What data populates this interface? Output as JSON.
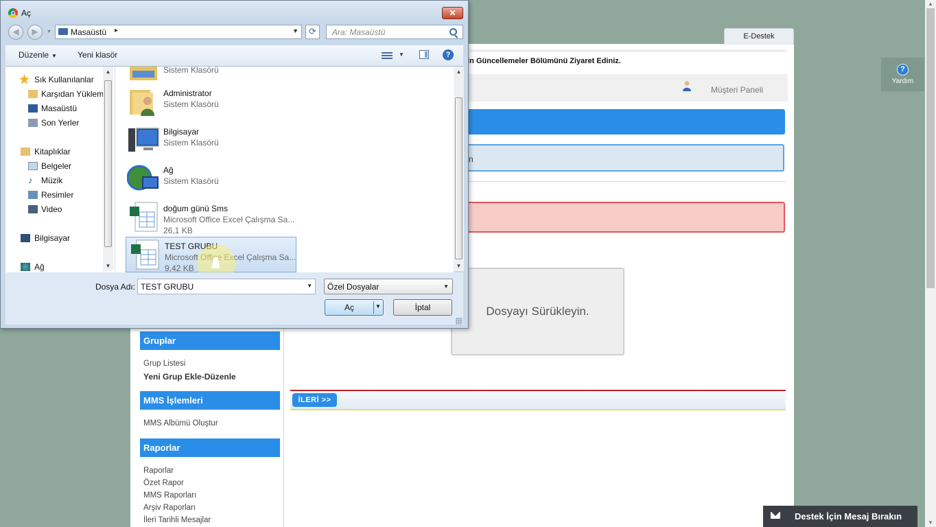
{
  "browser_page": {
    "tab_label": "E-Destek",
    "notice_text": "çin Güncellemeler Bölümünü Ziyaret Ediniz.",
    "customer_panel": "Müşteri Paneli",
    "info_fragment": "n",
    "drop_zone_text": "Dosyayı Sürükleyin.",
    "next_button": "İLERİ >>",
    "help_label": "Yardım",
    "chat_label": "Destek İçin Mesaj Bırakın",
    "sidebar": {
      "groups_header": "Gruplar",
      "groups_items": [
        "Grup Listesi",
        "Yeni Grup Ekle-Düzenle"
      ],
      "mms_header": "MMS İşlemleri",
      "mms_items": [
        "MMS Albümü Oluştur"
      ],
      "reports_header": "Raporlar",
      "reports_items": [
        "Raporlar",
        "Özet Rapor",
        "MMS Raporları",
        "Arşiv Raporları",
        "İleri Tarihli Mesajlar"
      ]
    }
  },
  "dialog": {
    "title": "Aç",
    "close_label": "✕",
    "address": {
      "location": "Masaüstü",
      "separator": "▸"
    },
    "search_placeholder": "Ara: Masaüstü",
    "toolbar": {
      "organize": "Düzenle",
      "new_folder": "Yeni klasör",
      "help": "?"
    },
    "nav_pane": {
      "favorites": "Sık Kullanılanlar",
      "favorites_items": [
        "Karşıdan Yüklem",
        "Masaüstü",
        "Son Yerler"
      ],
      "libraries": "Kitaplıklar",
      "libraries_items": [
        "Belgeler",
        "Müzik",
        "Resimler",
        "Video"
      ],
      "computer": "Bilgisayar",
      "network": "Ağ"
    },
    "files": [
      {
        "name": "",
        "type": "Sistem Klasörü",
        "size": "",
        "icon": "folder-icon"
      },
      {
        "name": "Administrator",
        "type": "Sistem Klasörü",
        "size": "",
        "icon": "user-folder-icon"
      },
      {
        "name": "Bilgisayar",
        "type": "Sistem Klasörü",
        "size": "",
        "icon": "computer-icon"
      },
      {
        "name": "Ağ",
        "type": "Sistem Klasörü",
        "size": "",
        "icon": "network-icon"
      },
      {
        "name": "doğum günü Sms",
        "type": "Microsoft Office Excel Çalışma Sa...",
        "size": "26,1 KB",
        "icon": "excel-file-icon"
      },
      {
        "name": "TEST GRUBU",
        "type": "Microsoft Office Excel Çalışma Sa...",
        "size": "9,42 KB",
        "icon": "excel-file-icon",
        "selected": true
      }
    ],
    "filename_label": "Dosya Adı:",
    "filename_value": "TEST GRUBU",
    "filetype_value": "Özel Dosyalar",
    "open_button": "Aç",
    "cancel_button": "İptal"
  },
  "colors": {
    "accent_blue": "#2a8ee8",
    "alert_red": "#e2555e",
    "desktop_bg": "#8fa89b"
  }
}
